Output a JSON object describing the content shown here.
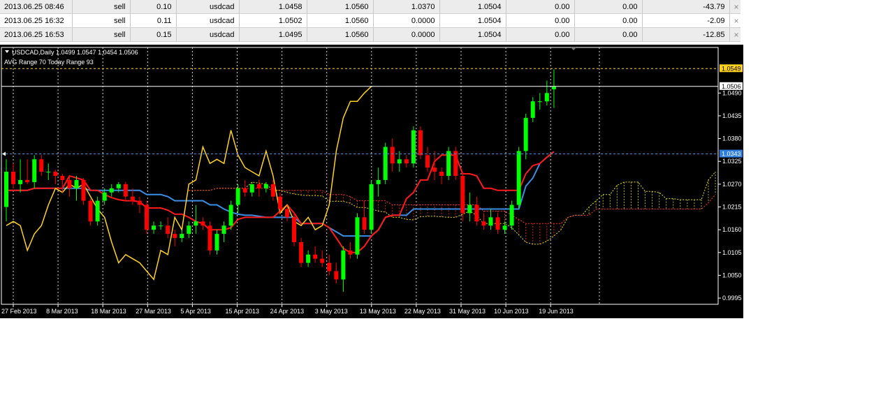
{
  "orders": [
    {
      "time": "2013.06.25 08:46",
      "type": "sell",
      "size": "0.10",
      "symbol": "usdcad",
      "price": "1.0458",
      "sl": "1.0560",
      "tp": "1.0370",
      "current": "1.0504",
      "commission": "0.00",
      "swap": "0.00",
      "profit": "-43.79",
      "close": "×"
    },
    {
      "time": "2013.06.25 16:32",
      "type": "sell",
      "size": "0.11",
      "symbol": "usdcad",
      "price": "1.0502",
      "sl": "1.0560",
      "tp": "0.0000",
      "current": "1.0504",
      "commission": "0.00",
      "swap": "0.00",
      "profit": "-2.09",
      "close": "×"
    },
    {
      "time": "2013.06.25 16:53",
      "type": "sell",
      "size": "0.15",
      "symbol": "usdcad",
      "price": "1.0495",
      "sl": "1.0560",
      "tp": "0.0000",
      "current": "1.0504",
      "commission": "0.00",
      "swap": "0.00",
      "profit": "-12.85",
      "close": "×"
    }
  ],
  "chart": {
    "header": "USDCAD,Daily  1.0499 1.0547 1.0454 1.0506",
    "subheader": "AVG Range 70    Today Range 93",
    "colors": {
      "background": "#000000",
      "bull": "#00ff00",
      "bear": "#ff0000",
      "tenkan": "#ff1a1a",
      "kijun": "#3a8ee6",
      "chikou": "#ffd21f",
      "cloud_up": "#ff3030",
      "cloud_dn": "#e6e600",
      "grid": "#ffffff",
      "text": "#ffffff"
    },
    "price_labels": [
      {
        "text": "1.0549",
        "bg": "#ffd21f",
        "color": "#000000"
      },
      {
        "text": "1.0506",
        "bg": "#ffffff",
        "color": "#000000"
      },
      {
        "text": "1.0343",
        "bg": "#2f7fe0",
        "color": "#ffffff"
      }
    ]
  },
  "chart_data": {
    "type": "candlestick",
    "symbol": "USDCAD",
    "timeframe": "Daily",
    "ylim": [
      0.998,
      1.06
    ],
    "y_ticks": [
      "1.0490",
      "1.0435",
      "1.0380",
      "1.0325",
      "1.0270",
      "1.0215",
      "1.0160",
      "1.0105",
      "1.0050",
      "0.9995"
    ],
    "x_ticks": [
      "27 Feb 2013",
      "8 Mar 2013",
      "18 Mar 2013",
      "27 Mar 2013",
      "5 Apr 2013",
      "15 Apr 2013",
      "24 Apr 2013",
      "3 May 2013",
      "13 May 2013",
      "22 May 2013",
      "31 May 2013",
      "10 Jun 2013",
      "19 Jun 2013"
    ],
    "candles": [
      [
        1.0215,
        1.033,
        1.018,
        1.03
      ],
      [
        1.03,
        1.032,
        1.026,
        1.027
      ],
      [
        1.027,
        1.033,
        1.025,
        1.028
      ],
      [
        1.028,
        1.033,
        1.027,
        1.0275
      ],
      [
        1.0275,
        1.034,
        1.026,
        1.033
      ],
      [
        1.033,
        1.034,
        1.029,
        1.03
      ],
      [
        1.03,
        1.032,
        1.028,
        1.03
      ],
      [
        1.03,
        1.0305,
        1.027,
        1.029
      ],
      [
        1.029,
        1.0295,
        1.025,
        1.028
      ],
      [
        1.028,
        1.029,
        1.024,
        1.026
      ],
      [
        1.026,
        1.029,
        1.023,
        1.028
      ],
      [
        1.028,
        1.0285,
        1.022,
        1.023
      ],
      [
        1.023,
        1.0235,
        1.017,
        1.018
      ],
      [
        1.018,
        1.024,
        1.017,
        1.023
      ],
      [
        1.023,
        1.026,
        1.022,
        1.025
      ],
      [
        1.025,
        1.027,
        1.024,
        1.026
      ],
      [
        1.026,
        1.0275,
        1.025,
        1.027
      ],
      [
        1.027,
        1.0275,
        1.023,
        1.024
      ],
      [
        1.024,
        1.026,
        1.022,
        1.023
      ],
      [
        1.023,
        1.024,
        1.02,
        1.022
      ],
      [
        1.022,
        1.023,
        1.015,
        1.016
      ],
      [
        1.016,
        1.018,
        1.015,
        1.017
      ],
      [
        1.017,
        1.018,
        1.016,
        1.017
      ],
      [
        1.017,
        1.019,
        1.014,
        1.015
      ],
      [
        1.015,
        1.016,
        1.012,
        1.014
      ],
      [
        1.014,
        1.016,
        1.013,
        1.015
      ],
      [
        1.015,
        1.018,
        1.014,
        1.017
      ],
      [
        1.017,
        1.022,
        1.015,
        1.018
      ],
      [
        1.018,
        1.019,
        1.016,
        1.017
      ],
      [
        1.017,
        1.018,
        1.01,
        1.011
      ],
      [
        1.011,
        1.016,
        1.01,
        1.015
      ],
      [
        1.015,
        1.018,
        1.013,
        1.017
      ],
      [
        1.017,
        1.023,
        1.016,
        1.022
      ],
      [
        1.022,
        1.027,
        1.02,
        1.026
      ],
      [
        1.026,
        1.028,
        1.024,
        1.025
      ],
      [
        1.025,
        1.027,
        1.024,
        1.027
      ],
      [
        1.027,
        1.028,
        1.024,
        1.026
      ],
      [
        1.026,
        1.0275,
        1.025,
        1.027
      ],
      [
        1.027,
        1.028,
        1.023,
        1.024
      ],
      [
        1.024,
        1.025,
        1.02,
        1.021
      ],
      [
        1.021,
        1.022,
        1.018,
        1.019
      ],
      [
        1.019,
        1.02,
        1.012,
        1.013
      ],
      [
        1.013,
        1.014,
        1.007,
        1.008
      ],
      [
        1.008,
        1.011,
        1.007,
        1.01
      ],
      [
        1.01,
        1.012,
        1.008,
        1.009
      ],
      [
        1.009,
        1.011,
        1.007,
        1.008
      ],
      [
        1.008,
        1.01,
        1.005,
        1.006
      ],
      [
        1.006,
        1.008,
        1.003,
        1.004
      ],
      [
        1.004,
        1.012,
        1.001,
        1.011
      ],
      [
        1.011,
        1.013,
        1.009,
        1.01
      ],
      [
        1.01,
        1.02,
        1.009,
        1.019
      ],
      [
        1.019,
        1.023,
        1.015,
        1.016
      ],
      [
        1.016,
        1.028,
        1.015,
        1.027
      ],
      [
        1.027,
        1.031,
        1.024,
        1.028
      ],
      [
        1.028,
        1.037,
        1.027,
        1.036
      ],
      [
        1.036,
        1.038,
        1.03,
        1.032
      ],
      [
        1.032,
        1.035,
        1.03,
        1.033
      ],
      [
        1.033,
        1.034,
        1.031,
        1.032
      ],
      [
        1.032,
        1.041,
        1.031,
        1.04
      ],
      [
        1.04,
        1.041,
        1.033,
        1.034
      ],
      [
        1.034,
        1.036,
        1.03,
        1.031
      ],
      [
        1.031,
        1.035,
        1.028,
        1.03
      ],
      [
        1.03,
        1.031,
        1.027,
        1.029
      ],
      [
        1.029,
        1.036,
        1.028,
        1.035
      ],
      [
        1.035,
        1.036,
        1.028,
        1.029
      ],
      [
        1.029,
        1.03,
        1.018,
        1.02
      ],
      [
        1.02,
        1.025,
        1.018,
        1.022
      ],
      [
        1.022,
        1.024,
        1.017,
        1.018
      ],
      [
        1.018,
        1.02,
        1.016,
        1.017
      ],
      [
        1.017,
        1.021,
        1.016,
        1.019
      ],
      [
        1.019,
        1.02,
        1.015,
        1.016
      ],
      [
        1.016,
        1.018,
        1.015,
        1.017
      ],
      [
        1.017,
        1.023,
        1.016,
        1.022
      ],
      [
        1.022,
        1.036,
        1.021,
        1.035
      ],
      [
        1.035,
        1.044,
        1.033,
        1.043
      ],
      [
        1.043,
        1.048,
        1.042,
        1.047
      ],
      [
        1.047,
        1.049,
        1.045,
        1.047
      ],
      [
        1.047,
        1.052,
        1.046,
        1.049
      ],
      [
        1.0499,
        1.0547,
        1.0454,
        1.0506
      ]
    ]
  }
}
